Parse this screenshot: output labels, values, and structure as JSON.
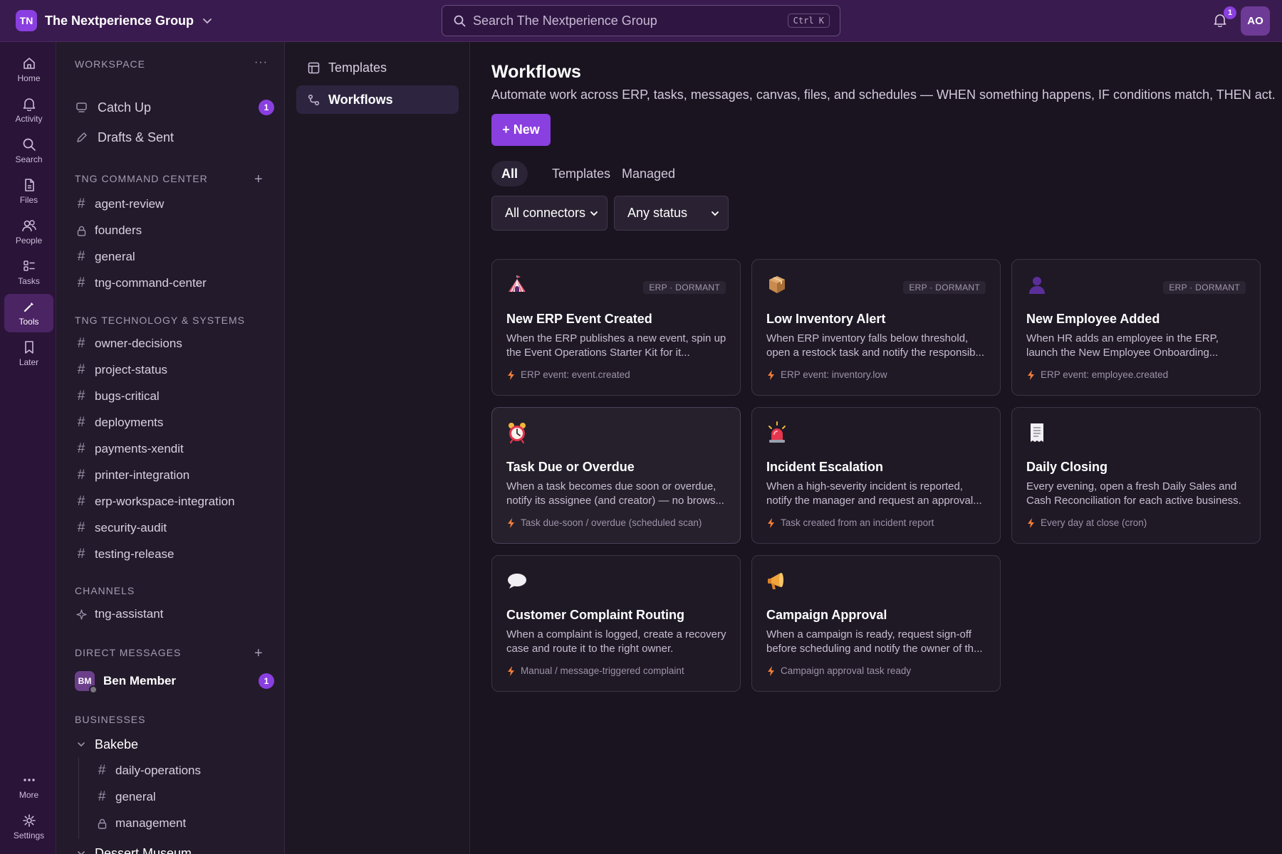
{
  "topbar": {
    "org_initials": "TN",
    "org_name": "The Nextperience Group",
    "search_placeholder": "Search The Nextperience Group",
    "search_shortcut": "Ctrl K",
    "notifications_count": "1",
    "user_initials": "AO"
  },
  "rail": {
    "items": [
      {
        "label": "Home",
        "icon": "home-icon"
      },
      {
        "label": "Activity",
        "icon": "bell-icon"
      },
      {
        "label": "Search",
        "icon": "search-icon"
      },
      {
        "label": "Files",
        "icon": "file-icon"
      },
      {
        "label": "People",
        "icon": "people-icon"
      },
      {
        "label": "Tasks",
        "icon": "tasks-icon"
      },
      {
        "label": "Tools",
        "icon": "tools-icon",
        "active": true
      },
      {
        "label": "Later",
        "icon": "bookmark-icon"
      }
    ],
    "bottom": [
      {
        "label": "More",
        "icon": "more-icon"
      },
      {
        "label": "Settings",
        "icon": "gear-icon"
      }
    ]
  },
  "sidebar": {
    "workspace": {
      "heading": "WORKSPACE",
      "items": [
        {
          "label": "Catch Up",
          "icon": "catchup-icon",
          "count": "1"
        },
        {
          "label": "Drafts & Sent",
          "icon": "pencil-icon"
        }
      ]
    },
    "command_center": {
      "heading": "TNG COMMAND CENTER",
      "items": [
        {
          "label": "agent-review",
          "icon": "hash"
        },
        {
          "label": "founders",
          "icon": "lock"
        },
        {
          "label": "general",
          "icon": "hash"
        },
        {
          "label": "tng-command-center",
          "icon": "hash"
        }
      ]
    },
    "tech": {
      "heading": "TNG TECHNOLOGY & SYSTEMS",
      "items": [
        {
          "label": "owner-decisions",
          "icon": "hash"
        },
        {
          "label": "project-status",
          "icon": "hash"
        },
        {
          "label": "bugs-critical",
          "icon": "hash"
        },
        {
          "label": "deployments",
          "icon": "hash"
        },
        {
          "label": "payments-xendit",
          "icon": "hash"
        },
        {
          "label": "printer-integration",
          "icon": "hash"
        },
        {
          "label": "erp-workspace-integration",
          "icon": "hash"
        },
        {
          "label": "security-audit",
          "icon": "hash"
        },
        {
          "label": "testing-release",
          "icon": "hash"
        }
      ]
    },
    "channels": {
      "heading": "CHANNELS",
      "items": [
        {
          "label": "tng-assistant",
          "icon": "sparkle"
        }
      ]
    },
    "direct_messages": {
      "heading": "DIRECT MESSAGES",
      "items": [
        {
          "label": "Ben Member",
          "initials": "BM",
          "count": "1"
        }
      ]
    },
    "businesses": {
      "heading": "BUSINESSES",
      "groups": [
        {
          "label": "Bakebe",
          "items": [
            {
              "label": "daily-operations",
              "icon": "hash"
            },
            {
              "label": "general",
              "icon": "hash"
            },
            {
              "label": "management",
              "icon": "lock"
            }
          ]
        },
        {
          "label": "Dessert Museum"
        }
      ]
    }
  },
  "subnav": {
    "items": [
      {
        "label": "Templates",
        "icon": "template-icon"
      },
      {
        "label": "Workflows",
        "icon": "workflow-icon",
        "active": true
      }
    ]
  },
  "main": {
    "title": "Workflows",
    "subtitle": "Automate work across ERP, tasks, messages, canvas, files, and schedules — WHEN something happens, IF conditions match, THEN act.",
    "new_button": "+ New",
    "tabs": [
      {
        "label": "All",
        "active": true
      },
      {
        "label": "Templates"
      },
      {
        "label": "Managed"
      }
    ],
    "filters": {
      "connector": "All connectors",
      "status": "Any status"
    },
    "cards": [
      {
        "emoji": "circus-tent",
        "tag": "ERP · DORMANT",
        "title": "New ERP Event Created",
        "desc": "When the ERP publishes a new event, spin up the Event Operations Starter Kit for it...",
        "trigger": "ERP event: event.created"
      },
      {
        "emoji": "package-box",
        "tag": "ERP · DORMANT",
        "title": "Low Inventory Alert",
        "desc": "When ERP inventory falls below threshold, open a restock task and notify the responsib...",
        "trigger": "ERP event: inventory.low"
      },
      {
        "emoji": "person-silhouette",
        "tag": "ERP · DORMANT",
        "title": "New Employee Added",
        "desc": "When HR adds an employee in the ERP, launch the New Employee Onboarding...",
        "trigger": "ERP event: employee.created"
      },
      {
        "emoji": "alarm-clock",
        "title": "Task Due or Overdue",
        "desc": "When a task becomes due soon or overdue, notify its assignee (and creator) — no brows...",
        "trigger": "Task due-soon / overdue (scheduled scan)"
      },
      {
        "emoji": "siren-light",
        "title": "Incident Escalation",
        "desc": "When a high-severity incident is reported, notify the manager and request an approval...",
        "trigger": "Task created from an incident report"
      },
      {
        "emoji": "receipt",
        "title": "Daily Closing",
        "desc": "Every evening, open a fresh Daily Sales and Cash Reconciliation for each active business.",
        "trigger": "Every day at close (cron)"
      },
      {
        "emoji": "speech-bubble",
        "title": "Customer Complaint Routing",
        "desc": "When a complaint is logged, create a recovery case and route it to the right owner.",
        "trigger": "Manual / message-triggered complaint"
      },
      {
        "emoji": "megaphone",
        "title": "Campaign Approval",
        "desc": "When a campaign is ready, request sign-off before scheduling and notify the owner of th...",
        "trigger": "Campaign approval task ready"
      }
    ]
  },
  "colors": {
    "accent": "#8a3fe0",
    "topbar": "#3a1b4f",
    "rail": "#2a1438",
    "sidebar": "#231a2b",
    "background": "#19141f",
    "bolt": "#f07d3a"
  }
}
